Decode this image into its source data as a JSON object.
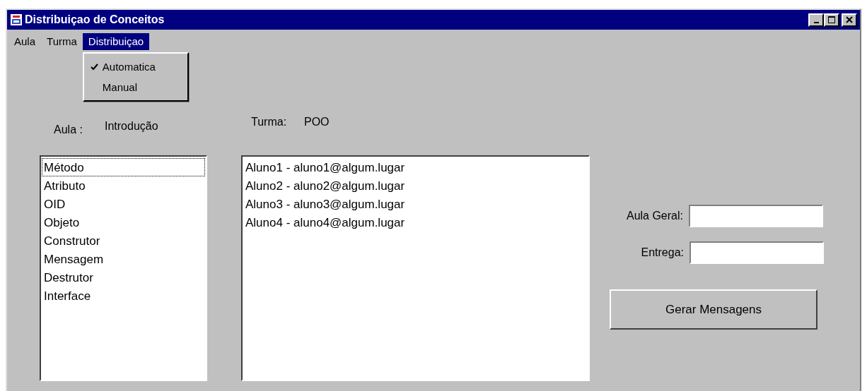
{
  "window": {
    "title": "Distribuiçao de Conceitos"
  },
  "menu_bar": [
    {
      "label": "Aula",
      "selected": false
    },
    {
      "label": "Turma",
      "selected": false
    },
    {
      "label": "Distribuiçao",
      "selected": true
    }
  ],
  "open_menu": [
    {
      "label": "Automatica",
      "checked": true
    },
    {
      "label": "Manual",
      "checked": false
    }
  ],
  "aula": {
    "label": "Aula :",
    "value": "Introdução"
  },
  "turma": {
    "label": "Turma:",
    "value": "POO"
  },
  "concepts": [
    {
      "text": "Método",
      "focused": true
    },
    {
      "text": "Atributo",
      "focused": false
    },
    {
      "text": "OID",
      "focused": false
    },
    {
      "text": "Objeto",
      "focused": false
    },
    {
      "text": "Construtor",
      "focused": false
    },
    {
      "text": "Mensagem",
      "focused": false
    },
    {
      "text": "Destrutor",
      "focused": false
    },
    {
      "text": "Interface",
      "focused": false
    }
  ],
  "students": [
    "Aluno1 - aluno1@algum.lugar",
    "Aluno2 - aluno2@algum.lugar",
    "Aluno3 - aluno3@algum.lugar",
    "Aluno4 - aluno4@algum.lugar"
  ],
  "fields": [
    {
      "label": "Aula Geral:"
    },
    {
      "label": "Entrega:"
    }
  ],
  "button": "Gerar Mensagens"
}
